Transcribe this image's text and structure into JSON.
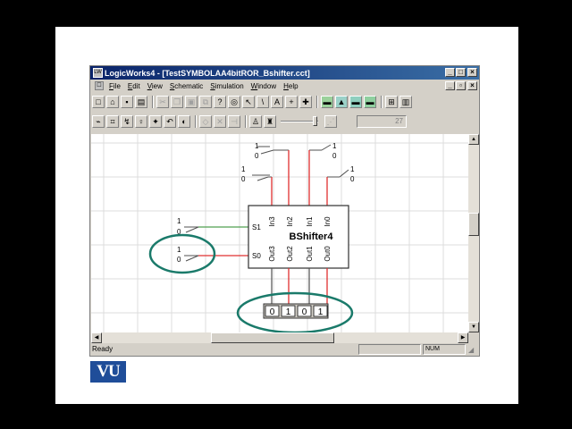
{
  "window": {
    "title": "LogicWorks4 - [TestSYMBOLAA4bitROR_Bshifter.cct]",
    "app_icon": "logicworks-icon",
    "caption_buttons": [
      "minimize-icon",
      "restore-icon",
      "close-icon"
    ],
    "doc_buttons": [
      "minimize-icon",
      "restore-icon",
      "close-icon"
    ]
  },
  "menu": {
    "items": [
      {
        "label": "File"
      },
      {
        "label": "Edit"
      },
      {
        "label": "View"
      },
      {
        "label": "Schematic"
      },
      {
        "label": "Simulation"
      },
      {
        "label": "Window"
      },
      {
        "label": "Help"
      }
    ]
  },
  "toolbar": {
    "zoom_value": "27"
  },
  "schematic": {
    "device_name": "BShifter4",
    "select_pins": [
      "S1",
      "S0"
    ],
    "input_pins": [
      "In3",
      "In2",
      "In1",
      "In0"
    ],
    "output_pins": [
      "Out3",
      "Out2",
      "Out1",
      "Out0"
    ],
    "binary_switches": [
      {
        "hi": "1",
        "lo": "0"
      },
      {
        "hi": "1",
        "lo": "0"
      },
      {
        "hi": "1",
        "lo": "0"
      },
      {
        "hi": "1",
        "lo": "0"
      },
      {
        "hi": "1",
        "lo": "0"
      },
      {
        "hi": "1",
        "lo": "0"
      }
    ],
    "probe_values": [
      "0",
      "1",
      "0",
      "1"
    ],
    "colors": {
      "wire_high": "#e03030",
      "wire_low": "#505050",
      "wire_select": "#50a050",
      "highlight": "#1a7a6a"
    }
  },
  "status": {
    "text": "Ready",
    "num": "NUM"
  },
  "logo": {
    "text": "VU"
  }
}
